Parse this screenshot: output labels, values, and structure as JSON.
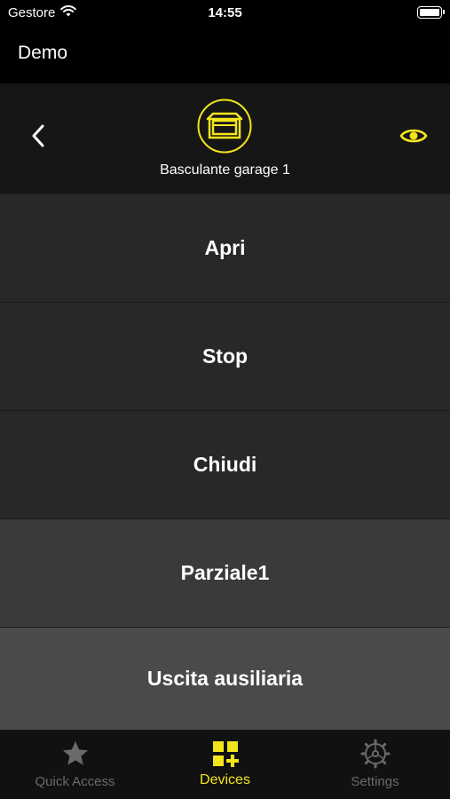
{
  "status_bar": {
    "carrier": "Gestore",
    "time": "14:55",
    "battery_level": 1.0
  },
  "app": {
    "title": "Demo"
  },
  "device": {
    "name": "Basculante garage 1",
    "icon": "garage-door-icon",
    "accent_color": "#f2e51b"
  },
  "commands": [
    {
      "label": "Apri"
    },
    {
      "label": "Stop"
    },
    {
      "label": "Chiudi"
    },
    {
      "label": "Parziale1"
    },
    {
      "label": "Uscita ausiliaria"
    }
  ],
  "tabs": [
    {
      "label": "Quick Access",
      "icon": "star-icon",
      "active": false
    },
    {
      "label": "Devices",
      "icon": "devices-grid-plus-icon",
      "active": true
    },
    {
      "label": "Settings",
      "icon": "gear-icon",
      "active": false
    }
  ]
}
